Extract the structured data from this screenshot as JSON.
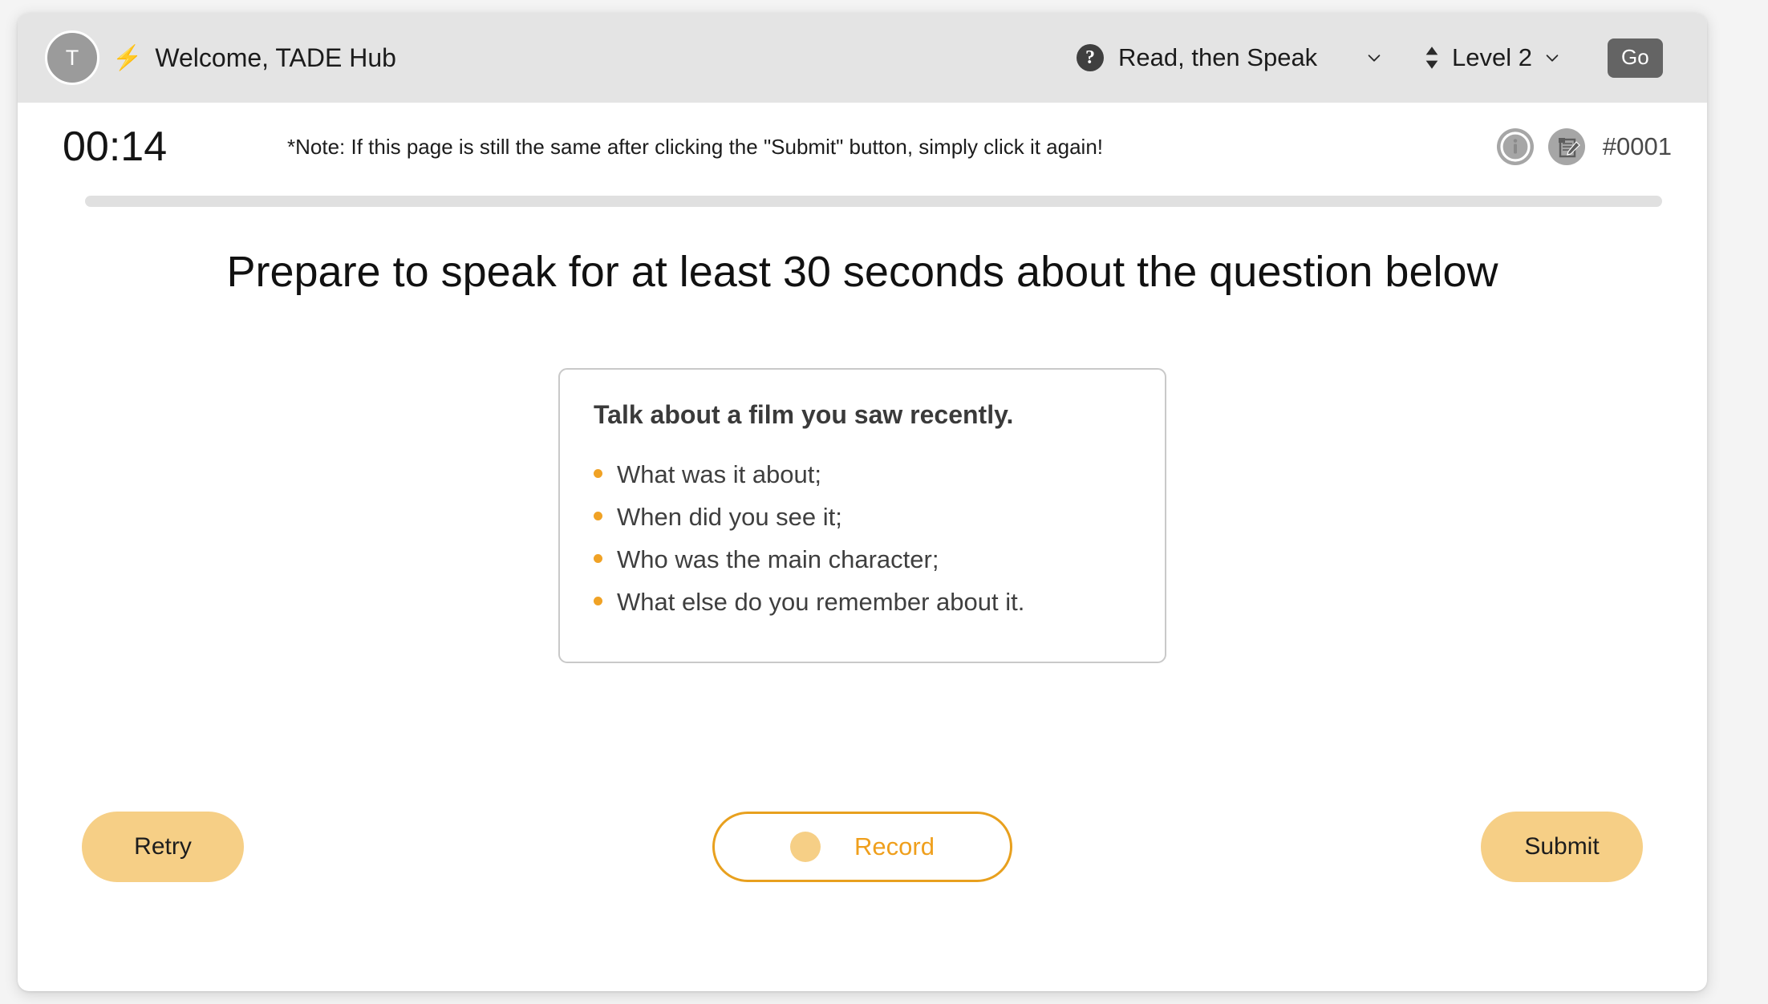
{
  "header": {
    "avatar_initial": "T",
    "bolt_icon": "lightning-bolt-icon",
    "brand_title": "Welcome, TADE Hub",
    "help_icon_glyph": "?",
    "task_mode": "Read, then Speak",
    "task_mode_options": [
      "Read, then Speak"
    ],
    "level": "Level 2",
    "level_options": [
      "Level 2"
    ],
    "go_label": "Go"
  },
  "status": {
    "timer": "00:14",
    "note": "*Note: If this page is still the same after clicking the \"Submit\" button, simply click it again!",
    "info_icon": "info-circle-icon",
    "notes_icon": "note-with-pen-icon",
    "item_id": "#0001",
    "progress_percent": 0
  },
  "main": {
    "heading": "Prepare to speak for at least 30 seconds about the question below",
    "question": {
      "title": "Talk about a film you saw recently.",
      "bullets": [
        "What was it about;",
        "When did you see it;",
        "Who was the main character;",
        "What else do you remember about it."
      ]
    }
  },
  "footer": {
    "retry_label": "Retry",
    "record_label": "Record",
    "submit_label": "Submit"
  },
  "colors": {
    "accent_orange": "#e8a01e",
    "accent_amber": "#f6cf86",
    "bullet_orange": "#f0a225",
    "header_bg": "#e4e4e4",
    "go_button_bg": "#646464",
    "avatar_bg": "#9b9b9b"
  }
}
